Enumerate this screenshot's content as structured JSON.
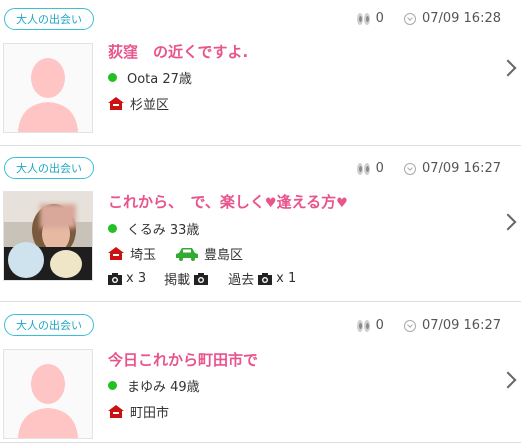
{
  "posts": [
    {
      "tag": "大人の出会い",
      "views": "0",
      "time": "07/09 16:28",
      "title": "荻窪　の近くですよ.",
      "user": "Oota 27歳",
      "area": "杉並区"
    },
    {
      "tag": "大人の出会い",
      "views": "0",
      "time": "07/09 16:27",
      "title": "これから、　で、楽しく",
      "title_after": "逢える方",
      "user": "くるみ 33歳",
      "area": "埼玉",
      "car_area": "豊島区",
      "photo_count": "x 3",
      "post_label": "掲載",
      "past_label": "過去",
      "past_count": "x 1"
    },
    {
      "tag": "大人の出会い",
      "views": "0",
      "time": "07/09 16:27",
      "title": "今日これから町田市で",
      "user": "まゆみ 49歳",
      "area": "町田市"
    }
  ],
  "colors": {
    "accent": "#e8548c",
    "tag": "#1ea8c4",
    "online": "#22c122",
    "house": "#cc1111",
    "car": "#33aa33"
  },
  "icons": [
    "eye-icon",
    "clock-icon",
    "house-icon",
    "car-icon",
    "camera-icon",
    "chevron-right-icon",
    "heart-icon"
  ]
}
